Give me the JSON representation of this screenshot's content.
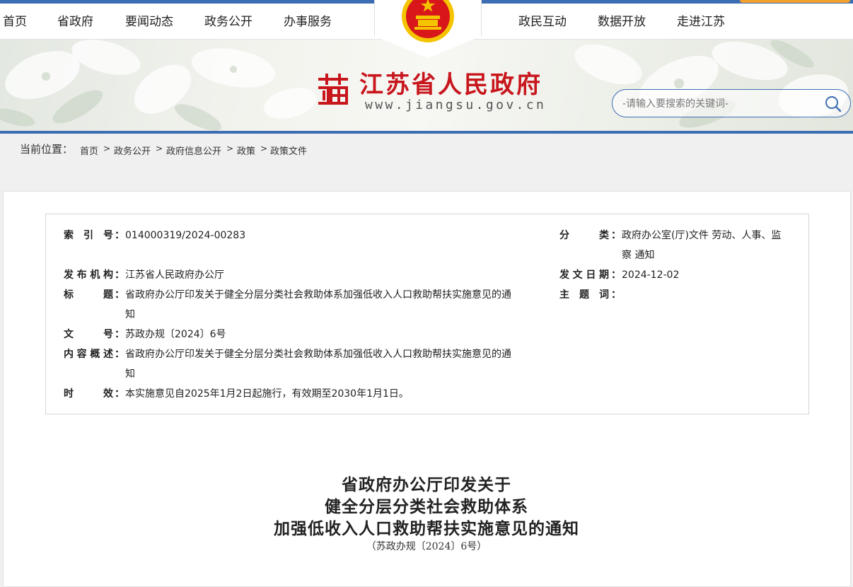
{
  "nav": {
    "left": [
      "首页",
      "省政府",
      "要闻动态",
      "政务公开",
      "办事服务"
    ],
    "right": [
      "政民互动",
      "数据开放",
      "走进江苏"
    ]
  },
  "header": {
    "site_title": "江苏省人民政府",
    "site_domain": "www.jiangsu.gov.cn",
    "search_placeholder": "-请输入要搜索的关键词-"
  },
  "breadcrumb": {
    "label": "当前位置：",
    "items": [
      "首页",
      "政务公开",
      "政府信息公开",
      "政策",
      "政策文件"
    ],
    "separator": ">"
  },
  "info": {
    "index_label": "索 引 号",
    "index_value": "014000319/2024-00283",
    "category_label": "分 类",
    "category_value_1": "政府办公室(厅)文件 劳动、人事、监",
    "category_value_2": "察 通知",
    "issuer_label": "发布机构",
    "issuer_value": "江苏省人民政府办公厅",
    "date_label": "发文日期",
    "date_value": "2024-12-02",
    "title_label": "标 题",
    "title_value_1": "省政府办公厅印发关于健全分层分类社会救助体系加强低收入人口救助帮扶实施意见的通",
    "title_value_2": "知",
    "keywords_label": "主 题 词",
    "keywords_value": "",
    "docno_label": "文 号",
    "docno_value": "苏政办规〔2024〕6号",
    "summary_label": "内容概述",
    "summary_value_1": "省政府办公厅印发关于健全分层分类社会救助体系加强低收入人口救助帮扶实施意见的通",
    "summary_value_2": "知",
    "validity_label": "时 效",
    "validity_value": "本实施意见自2025年1月2日起施行，有效期至2030年1月1日。",
    "colon": "："
  },
  "document": {
    "title_line_1": "省政府办公厅印发关于",
    "title_line_2": "健全分层分类社会救助体系",
    "title_line_3": "加强低收入人口救助帮扶实施意见的通知",
    "number": "（苏政办规〔2024〕6号）"
  },
  "colors": {
    "brand_blue": "#3d6db3",
    "brand_red": "#c8161d",
    "accent_orange": "#f3a02d",
    "emblem_gold": "#f5c400"
  },
  "icons": {
    "emblem": "national-emblem-icon",
    "logo": "jiangsu-su-logo-icon",
    "search": "search-icon"
  }
}
